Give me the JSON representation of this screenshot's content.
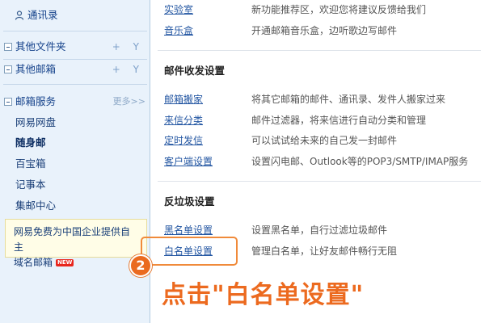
{
  "sidebar": {
    "contacts": "通讯录",
    "other_folders": "其他文件夹",
    "other_mailboxes": "其他邮箱",
    "plus_y": "+ Y",
    "mailbox_services": "邮箱服务",
    "more": "更多>>",
    "items": [
      "网易网盘",
      "随身邮",
      "百宝箱",
      "记事本",
      "集邮中心"
    ],
    "promo_line1": "网易免费为中国企业提供自主",
    "promo_line2": "域名邮箱",
    "new_badge": "NEW"
  },
  "main": {
    "top_rows": [
      {
        "link": "实验室",
        "desc": "新功能推荐区，欢迎您将建议反馈给我们"
      },
      {
        "link": "音乐盒",
        "desc": "开通邮箱音乐盒，边听歌边写邮件"
      }
    ],
    "section_mail": "邮件收发设置",
    "mail_rows": [
      {
        "link": "邮箱搬家",
        "desc": "将其它邮箱的邮件、通讯录、发件人搬家过来"
      },
      {
        "link": "来信分类",
        "desc": "邮件过滤器，将来信进行自动分类和管理"
      },
      {
        "link": "定时发信",
        "desc": "可以试试给未来的自己发一封邮件"
      },
      {
        "link": "客户端设置",
        "desc": "设置闪电邮、Outlook等的POP3/SMTP/IMAP服务"
      }
    ],
    "section_spam": "反垃圾设置",
    "spam_rows": [
      {
        "link": "黑名单设置",
        "desc": "设置黑名单，自行过滤垃圾邮件"
      },
      {
        "link": "白名单设置",
        "desc": "管理白名单，让好友邮件畅行无阻"
      }
    ]
  },
  "annotation": {
    "step": "2",
    "callout": "点击\"白名单设置\""
  }
}
